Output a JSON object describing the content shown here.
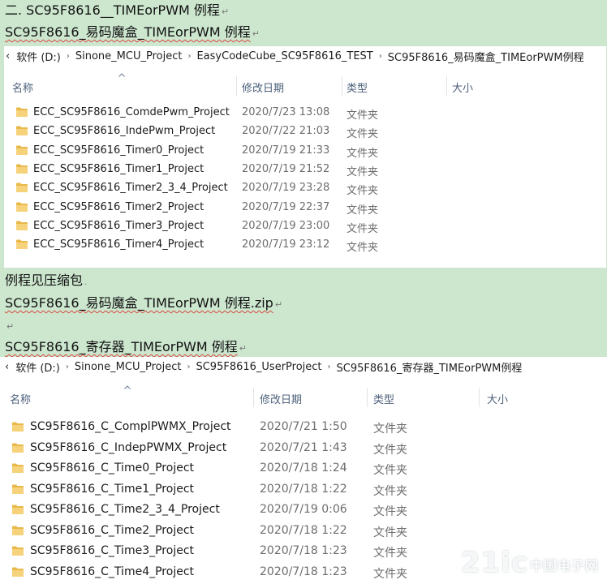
{
  "doc": {
    "line1": "二.   SC95F8616__TIMEorPWM 例程",
    "line2": "SC95F8616_易码魔盒_TIMEorPWM 例程",
    "line3": "例程见压缩包",
    "line4": "SC95F8616_易码魔盒_TIMEorPWM 例程.zip",
    "line5": "",
    "line6": "SC95F8616_寄存器_TIMEorPWM 例程",
    "para_mark": "↵",
    "dot_mark": "."
  },
  "explorer1": {
    "breadcrumb": [
      "软件 (D:)",
      "Sinone_MCU_Project",
      "EasyCodeCube_SC95F8616_TEST",
      "SC95F8616_易码魔盒_TIMEorPWM例程"
    ],
    "columns": {
      "name": "名称",
      "date": "修改日期",
      "type": "类型",
      "size": "大小"
    },
    "rows": [
      {
        "name": "ECC_SC95F8616_ComdePwm_Project",
        "date": "2020/7/23 13:08",
        "type": "文件夹"
      },
      {
        "name": "ECC_SC95F8616_IndePwm_Project",
        "date": "2020/7/22 21:03",
        "type": "文件夹"
      },
      {
        "name": "ECC_SC95F8616_Timer0_Project",
        "date": "2020/7/19 21:33",
        "type": "文件夹"
      },
      {
        "name": "ECC_SC95F8616_Timer1_Project",
        "date": "2020/7/19 21:52",
        "type": "文件夹"
      },
      {
        "name": "ECC_SC95F8616_Timer2_3_4_Project",
        "date": "2020/7/19 23:28",
        "type": "文件夹"
      },
      {
        "name": "ECC_SC95F8616_Timer2_Project",
        "date": "2020/7/19 22:37",
        "type": "文件夹"
      },
      {
        "name": "ECC_SC95F8616_Timer3_Project",
        "date": "2020/7/19 23:00",
        "type": "文件夹"
      },
      {
        "name": "ECC_SC95F8616_Timer4_Project",
        "date": "2020/7/19 23:12",
        "type": "文件夹"
      }
    ]
  },
  "explorer2": {
    "breadcrumb": [
      "软件 (D:)",
      "Sinone_MCU_Project",
      "SC95F8616_UserProject",
      "SC95F8616_寄存器_TIMEorPWM例程"
    ],
    "columns": {
      "name": "名称",
      "date": "修改日期",
      "type": "类型",
      "size": "大小"
    },
    "rows": [
      {
        "name": "SC95F8616_C_ComplPWMX_Project",
        "date": "2020/7/21 1:50",
        "type": "文件夹"
      },
      {
        "name": "SC95F8616_C_IndepPWMX_Project",
        "date": "2020/7/21 1:43",
        "type": "文件夹"
      },
      {
        "name": "SC95F8616_C_Time0_Project",
        "date": "2020/7/18 1:24",
        "type": "文件夹"
      },
      {
        "name": "SC95F8616_C_Time1_Project",
        "date": "2020/7/18 1:22",
        "type": "文件夹"
      },
      {
        "name": "SC95F8616_C_Time2_3_4_Project",
        "date": "2020/7/19 0:06",
        "type": "文件夹"
      },
      {
        "name": "SC95F8616_C_Time2_Project",
        "date": "2020/7/18 1:22",
        "type": "文件夹"
      },
      {
        "name": "SC95F8616_C_Time3_Project",
        "date": "2020/7/18 1:23",
        "type": "文件夹"
      },
      {
        "name": "SC95F8616_C_Time4_Project",
        "date": "2020/7/18 1:23",
        "type": "文件夹"
      }
    ]
  },
  "watermark": {
    "text": "21ic",
    "sub": "中国电子网"
  },
  "colors": {
    "doc_bg": "#cde7cf",
    "folder": "#e8b84a",
    "header_text": "#4c607a"
  }
}
